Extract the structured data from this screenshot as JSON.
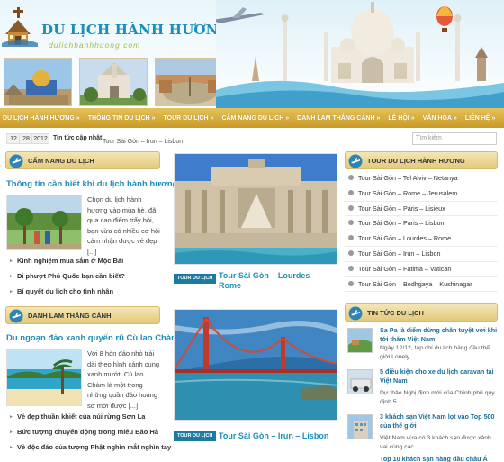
{
  "site": {
    "logo_title": "DU LỊCH HÀNH HƯƠNG",
    "logo_subtitle": "dulichhanhhuong.com"
  },
  "nav": {
    "items": [
      "DU LỊCH HÀNH HƯƠNG",
      "THÔNG TIN DU LỊCH",
      "TOUR DU LỊCH",
      "CẨM NANG DU LỊCH",
      "DANH LAM THẮNG CẢNH",
      "LỄ HỘI",
      "VĂN HÓA",
      "LIÊN HỆ"
    ],
    "arrow": "»"
  },
  "datebar": {
    "month": "12",
    "day": "28",
    "year": "2012",
    "ticker_label": "Tin tức cập nhật:",
    "ticker_text": "Tour Sài Gòn – Irun – Lisbon",
    "search_placeholder": "Tìm kiếm"
  },
  "cam_nang": {
    "heading": "CẨM NANG DU LỊCH",
    "lead_title": "Thông tin cần biết khi du lịch hành hương",
    "lead_text": "Chọn du lịch hành hương vào mùa hè, đã qua cao điểm trẩy hội, bạn vừa có nhiều cơ hội cảm nhận được vẻ đẹp [...]",
    "links": [
      "Kinh nghiệm mua sắm ở Mộc Bài",
      "Đi phượt Phú Quốc bạn cần biết?",
      "Bí quyết du lịch cho tình nhân"
    ]
  },
  "danh_lam": {
    "heading": "DANH LAM THẮNG CẢNH",
    "lead_title": "Du ngoạn đảo xanh quyến rũ Cù lao Chàm",
    "lead_text": "Với 8 hòn đảo nhỏ trải dài theo hình cánh cung xanh mướt, Cù lao Chàm là một trong những quần đảo hoang sơ mời được [...]",
    "links": [
      "Vẻ đẹp thuần khiết của núi rừng Sơn La",
      "Bức tượng chuyển động trong miếu Bảo Hà",
      "Vẻ độc đáo của tượng Phật nghìn mắt nghìn tay"
    ]
  },
  "middle": {
    "posts": [
      {
        "tag": "TOUR DU LỊCH",
        "title": "Tour Sài Gòn – Lourdes – Rome"
      },
      {
        "tag": "TOUR DU LỊCH",
        "title": "Tour Sài Gòn – Irun – Lisbon"
      }
    ]
  },
  "tour_box": {
    "heading": "TOUR DU LỊCH HÀNH HƯƠNG",
    "items": [
      "Tour Sài Gòn – Tel Alviv – Netanya",
      "Tour Sài Gòn – Rome – Jerusalem",
      "Tour Sài Gòn – Paris – Lisieux",
      "Tour Sài Gòn – Paris – Lisbon",
      "Tour Sài Gòn – Lourdes – Rome",
      "Tour Sài Gòn – Irun – Lisbon",
      "Tour Sài Gòn – Fatima – Vatican",
      "Tour Sài Gòn – Bodhgaya – Kushinagar"
    ]
  },
  "news_box": {
    "heading": "TIN TỨC DU LỊCH",
    "items": [
      {
        "title": "Sa Pa là điểm dừng chân tuyệt vời khi tới thăm Việt Nam",
        "desc": "Ngày 12/12, tạp chí du lịch hàng đầu thế giới Lonely..."
      },
      {
        "title": "5 điều kiện cho xe du lịch caravan tại Việt Nam",
        "desc": "Dự thảo Nghị định mới của Chính phủ quy định 5..."
      },
      {
        "title": "3 khách sạn Việt Nam lọt vào Top 500 của thế giới",
        "desc": "Việt Nam vừa có 3 khách sạn được xảnh vai cùng các..."
      },
      {
        "title": "Top 10 khách sạn hàng đầu châu Á",
        "desc": ""
      }
    ]
  },
  "colors": {
    "brand_blue": "#1c8fb8",
    "nav_gold": "#d4a935",
    "box_gold": "#e8d48f"
  }
}
